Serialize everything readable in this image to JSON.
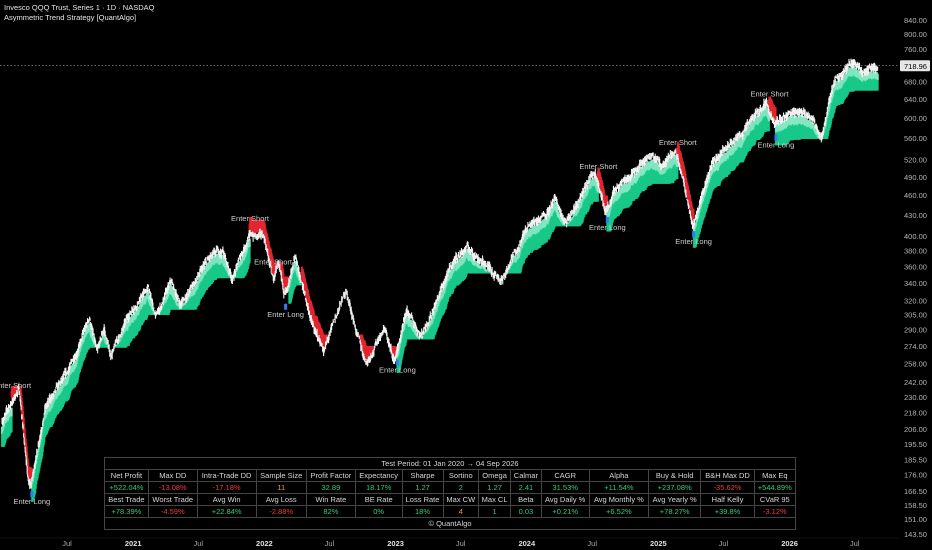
{
  "header": {
    "title": "Invesco QQQ Trust, Series 1 · 1D · NASDAQ",
    "subtitle": "Asymmetric Trend Strategy [QuantAlgo]"
  },
  "colors": {
    "up": "#19c98a",
    "up_dark": "#0b6b4c",
    "down": "#e3262f",
    "signal": "#2f7df6",
    "price_tag_bg": "#e6e6e6"
  },
  "chart_data": {
    "type": "line",
    "title": "",
    "xlabel": "",
    "ylabel": "",
    "y_scale": "log",
    "ylim": [
      143.5,
      840
    ],
    "y_ticks": [
      840.0,
      800.0,
      760.0,
      718.96,
      680.0,
      640.0,
      600.0,
      560.0,
      520.0,
      490.0,
      460.0,
      430.0,
      400.0,
      380.0,
      360.0,
      340.0,
      320.0,
      305.0,
      290.0,
      274.0,
      258.0,
      242.0,
      230.0,
      218.0,
      206.0,
      195.5,
      185.5,
      176.0,
      166.5,
      158.5,
      151.0,
      143.5
    ],
    "last_price": 718.96,
    "x_ticks": [
      "Jul",
      "2021",
      "Jul",
      "2022",
      "Jul",
      "2023",
      "Jul",
      "2024",
      "Jul",
      "2025",
      "Jul",
      "2026",
      "Jul"
    ],
    "x_tick_dates": [
      "2020-07-01",
      "2021-01-01",
      "2021-07-01",
      "2022-01-01",
      "2022-07-01",
      "2023-01-01",
      "2023-07-01",
      "2024-01-01",
      "2024-07-01",
      "2025-01-01",
      "2025-07-01",
      "2026-01-01",
      "2026-07-01"
    ],
    "xlim": [
      "2020-01-02",
      "2026-09-04"
    ],
    "series": [
      {
        "x": [
          "2020-01-02",
          "2020-02-19",
          "2020-03-16",
          "2020-03-23",
          "2020-04-30",
          "2020-06-30",
          "2020-09-02",
          "2020-09-23",
          "2020-10-12",
          "2020-10-30",
          "2020-12-31",
          "2021-02-12",
          "2021-03-05",
          "2021-04-16",
          "2021-05-12",
          "2021-07-30",
          "2021-09-07",
          "2021-10-04",
          "2021-11-19",
          "2021-12-31",
          "2022-01-27",
          "2022-02-09",
          "2022-02-24",
          "2022-03-29",
          "2022-05-20",
          "2022-06-16",
          "2022-08-16",
          "2022-09-30",
          "2022-10-13",
          "2022-11-30",
          "2022-12-28",
          "2023-02-02",
          "2023-03-13",
          "2023-06-15",
          "2023-07-19",
          "2023-10-26",
          "2023-12-28",
          "2024-03-21",
          "2024-04-19",
          "2024-07-10",
          "2024-08-05",
          "2024-09-06",
          "2024-12-16",
          "2025-01-13",
          "2025-02-19",
          "2025-04-08",
          "2025-05-30",
          "2025-08-29",
          "2025-10-29",
          "2025-11-20",
          "2025-12-31",
          "2026-02-25",
          "2026-03-31",
          "2026-05-08",
          "2026-06-30",
          "2026-07-24",
          "2026-09-04"
        ],
        "values": [
          212,
          237,
          170,
          170,
          222,
          247,
          302,
          266,
          290,
          265,
          313,
          335,
          302,
          340,
          316,
          368,
          380,
          346,
          402,
          398,
          342,
          367,
          322,
          367,
          288,
          270,
          332,
          268,
          260,
          293,
          260,
          307,
          285,
          370,
          385,
          345,
          408,
          450,
          415,
          502,
          435,
          472,
          535,
          508,
          535,
          420,
          515,
          575,
          635,
          585,
          612,
          614,
          565,
          690,
          730,
          705,
          719
        ]
      }
    ],
    "annotations": [
      "Enter Short",
      "Enter Long",
      "Enter Short",
      "Enter Short",
      "Enter Long",
      "Enter Long",
      "Enter Short",
      "Enter Long",
      "Enter Short",
      "Enter Long",
      "Enter Short",
      "Enter Long"
    ],
    "signal_dates": [
      [
        "short",
        "2020-01-30"
      ],
      [
        "long",
        "2020-03-25"
      ],
      [
        "short",
        "2021-11-22"
      ],
      [
        "short",
        "2022-01-25"
      ],
      [
        "long",
        "2022-03-01"
      ],
      [
        "long",
        "2023-01-06"
      ],
      [
        "short",
        "2024-07-18"
      ],
      [
        "long",
        "2024-08-12"
      ],
      [
        "short",
        "2025-02-24"
      ],
      [
        "long",
        "2025-04-09"
      ],
      [
        "short",
        "2025-11-06"
      ],
      [
        "long",
        "2025-11-24"
      ]
    ],
    "down_ranges": [
      [
        "2020-01-30",
        "2020-03-25"
      ],
      [
        "2021-11-22",
        "2022-03-10"
      ],
      [
        "2022-04-15",
        "2023-01-06"
      ],
      [
        "2024-07-18",
        "2024-08-12"
      ],
      [
        "2025-02-24",
        "2025-04-09"
      ],
      [
        "2025-11-06",
        "2025-11-24"
      ]
    ]
  },
  "stats": {
    "period_label": "Test Period:  01 Jan 2020  →  04 Sep 2026",
    "row1_labels": [
      "Net Profit",
      "Max DD",
      "Intra-Trade DD",
      "Sample Size",
      "Profit Factor",
      "Expectancy",
      "Sharpe",
      "Sortino",
      "Omega",
      "Calmar",
      "CAGR",
      "Alpha",
      "Buy & Hold",
      "B&H Max DD",
      "Max Eq"
    ],
    "row1_values": [
      "+522.04%",
      "-13.08%",
      "-17.18%",
      "11",
      "32.89",
      "18.17%",
      "1.27",
      "2",
      "1.27",
      "2.41",
      "31.53%",
      "+11.54%",
      "+237.08%",
      "-35.62%",
      "+544.89%"
    ],
    "row1_classes": [
      "pos",
      "neg",
      "neg",
      "neu",
      "pos",
      "pos",
      "pos",
      "pos",
      "pos",
      "pos",
      "pos",
      "pos",
      "pos",
      "neg",
      "pos"
    ],
    "row2_labels": [
      "Best Trade",
      "Worst Trade",
      "Avg Win",
      "Avg Loss",
      "Win Rate",
      "BE Rate",
      "Loss Rate",
      "Max CW",
      "Max CL",
      "Beta",
      "Avg Daily %",
      "Avg Monthly %",
      "Avg Yearly %",
      "Half Kelly",
      "CVaR 95"
    ],
    "row2_values": [
      "+78.39%",
      "-4.59%",
      "+22.84%",
      "-2.88%",
      "82%",
      "0%",
      "18%",
      "4",
      "1",
      "0.03",
      "+0.21%",
      "+6.52%",
      "+78.27%",
      "+39.8%",
      "-3.12%"
    ],
    "row2_classes": [
      "pos",
      "neg",
      "pos",
      "neg",
      "pos",
      "pos",
      "pos",
      "neu",
      "pos",
      "pos",
      "pos",
      "pos",
      "pos",
      "pos",
      "neg"
    ],
    "footer": "© QuantAlgo"
  }
}
